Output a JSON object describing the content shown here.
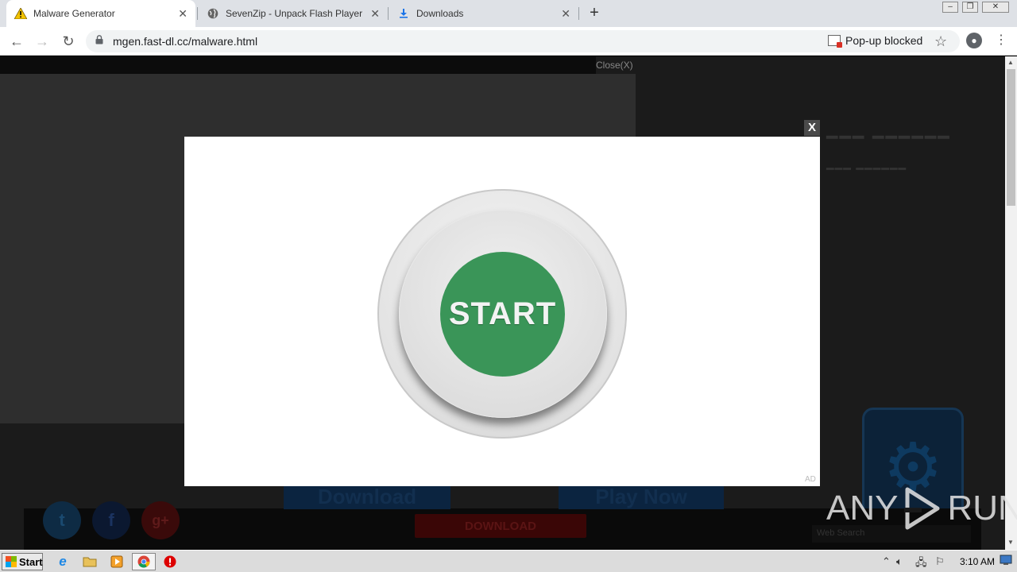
{
  "browser": {
    "tabs": [
      {
        "label": "Malware Generator",
        "icon": "warning-icon",
        "active": true
      },
      {
        "label": "SevenZip - Unpack Flash Player",
        "icon": "globe-icon",
        "active": false
      },
      {
        "label": "Downloads",
        "icon": "download-icon",
        "active": false
      }
    ],
    "new_tab": "+",
    "url": "mgen.fast-dl.cc/malware.html",
    "popup_blocked": "Pop-up blocked"
  },
  "page": {
    "background": {
      "close_text": "Close(X)",
      "download_label": "DOWNLOAD",
      "blue_button_1": "Download",
      "blue_button_2": "Play Now",
      "search_placeholder": "Web Search",
      "social": [
        "t",
        "f",
        "g+"
      ]
    },
    "modal": {
      "close_label": "X",
      "button_label": "START",
      "ad_label": "AD",
      "accent_color": "#3a9558"
    }
  },
  "watermark": {
    "left": "ANY",
    "right": "RUN"
  },
  "taskbar": {
    "start_label": "Start",
    "clock": "3:10 AM"
  }
}
